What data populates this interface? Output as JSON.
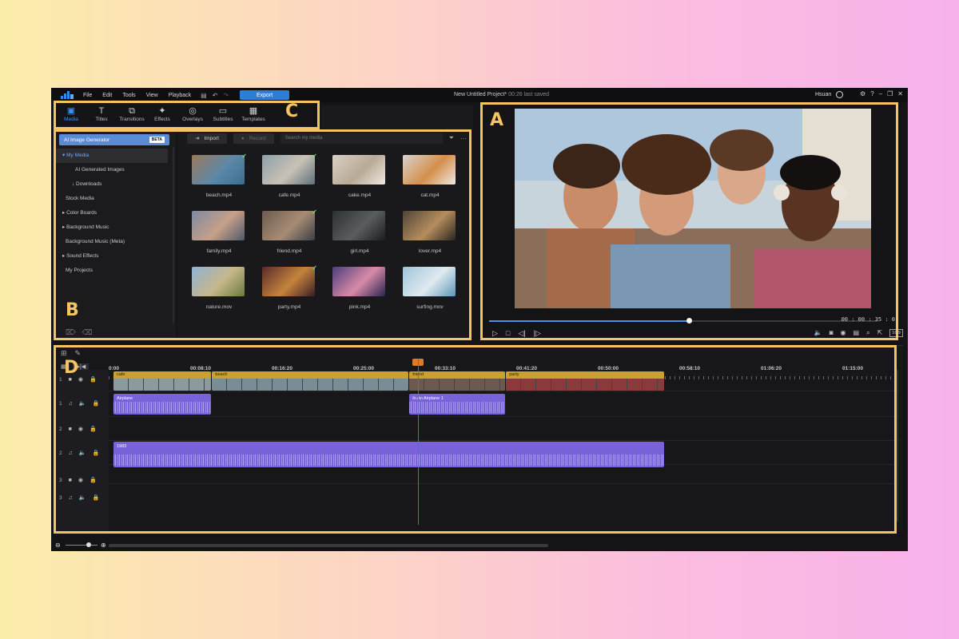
{
  "window": {
    "menu": [
      "File",
      "Edit",
      "Tools",
      "View",
      "Playback"
    ],
    "export_label": "Export",
    "project_title": "New Untitled Project*",
    "last_saved": "00:26 last saved",
    "user_name": "Hsuan"
  },
  "tabs": [
    {
      "label": "Media",
      "icon": "media-icon",
      "glyph": "▣",
      "active": true
    },
    {
      "label": "Titles",
      "icon": "titles-icon",
      "glyph": "T",
      "active": false
    },
    {
      "label": "Transitions",
      "icon": "transitions-icon",
      "glyph": "⧉",
      "active": false
    },
    {
      "label": "Effects",
      "icon": "effects-icon",
      "glyph": "✦",
      "active": false
    },
    {
      "label": "Overlays",
      "icon": "overlays-icon",
      "glyph": "◎",
      "active": false
    },
    {
      "label": "Subtitles",
      "icon": "subtitles-icon",
      "glyph": "▭",
      "active": false
    },
    {
      "label": "Templates",
      "icon": "templates-icon",
      "glyph": "▦",
      "active": false
    }
  ],
  "sidebar": {
    "ai_generator": "AI Image Generator",
    "beta": "BETA",
    "items": [
      {
        "label": "▾ My Media",
        "indent": 8,
        "selected": true
      },
      {
        "label": "AI Generated Images",
        "indent": 24,
        "selected": false
      },
      {
        "label": "↓ Downloads",
        "indent": 20,
        "selected": false
      },
      {
        "label": "Stock Media",
        "indent": 12,
        "selected": false
      },
      {
        "label": "▸ Color Boards",
        "indent": 8,
        "selected": false
      },
      {
        "label": "▸ Background Music",
        "indent": 8,
        "selected": false
      },
      {
        "label": "Background Music (Meta)",
        "indent": 12,
        "selected": false
      },
      {
        "label": "▸ Sound Effects",
        "indent": 8,
        "selected": false
      },
      {
        "label": "My Projects",
        "indent": 12,
        "selected": false
      }
    ]
  },
  "media": {
    "import_label": "Import",
    "record_label": "Record",
    "search_placeholder": "Search my media",
    "files": [
      {
        "name": "beach.mp4",
        "checked": true,
        "colors": [
          "#9c7a5a",
          "#5c88a8",
          "#3b6d8f"
        ]
      },
      {
        "name": "cafe.mp4",
        "checked": true,
        "colors": [
          "#8ea0a8",
          "#c9c2b6",
          "#5d6f78"
        ]
      },
      {
        "name": "cake.mp4",
        "checked": false,
        "colors": [
          "#d8d0c6",
          "#b9aa96",
          "#efe9e1"
        ]
      },
      {
        "name": "cat.mp4",
        "checked": false,
        "colors": [
          "#d8d3cd",
          "#d48f4c",
          "#efeae4"
        ]
      },
      {
        "name": "family.mp4",
        "checked": false,
        "colors": [
          "#7e8aa0",
          "#c7a08a",
          "#4d5a6a"
        ]
      },
      {
        "name": "friend.mp4",
        "checked": true,
        "colors": [
          "#6b5a50",
          "#a88c74",
          "#3a3e48"
        ]
      },
      {
        "name": "girl.mp4",
        "checked": false,
        "colors": [
          "#2e3134",
          "#5a5d60",
          "#1b1c1e"
        ]
      },
      {
        "name": "lover.mp4",
        "checked": false,
        "colors": [
          "#4f4438",
          "#b58d5e",
          "#2a2620"
        ]
      },
      {
        "name": "nature.mov",
        "checked": false,
        "colors": [
          "#8fb3d6",
          "#c7b68a",
          "#6a7a3c"
        ]
      },
      {
        "name": "party.mp4",
        "checked": true,
        "colors": [
          "#5a2a2a",
          "#c5843c",
          "#3a1c26"
        ]
      },
      {
        "name": "pink.mp4",
        "checked": false,
        "colors": [
          "#4b3f7c",
          "#d88aa8",
          "#2a2450"
        ]
      },
      {
        "name": "surfing.mov",
        "checked": false,
        "colors": [
          "#9fc4da",
          "#dfeaf0",
          "#5c96b8"
        ]
      }
    ]
  },
  "preview": {
    "timecode": "00 : 00 : 35 : 0",
    "progress": 0.51,
    "ratio": "16:9"
  },
  "timeline": {
    "ruler_labels": [
      "0:00",
      "00:08:10",
      "00:16:20",
      "00:25:00",
      "00:33:10",
      "00:41:20",
      "00:50:00",
      "00:58:10",
      "01:06:20",
      "01:15:00"
    ],
    "tracks": [
      {
        "number": "1",
        "type": "video"
      },
      {
        "number": "1",
        "type": "audio"
      },
      {
        "number": "2",
        "type": "video"
      },
      {
        "number": "2",
        "type": "audio"
      },
      {
        "number": "3",
        "type": "video"
      },
      {
        "number": "3",
        "type": "audio"
      }
    ],
    "video_clips": [
      {
        "label": "cafe",
        "start_s": 0,
        "end_s": 10.2,
        "color": "#8c9aa0"
      },
      {
        "label": "beach",
        "start_s": 10.2,
        "end_s": 30.6,
        "color": "#7a8c96"
      },
      {
        "label": "friend",
        "start_s": 30.6,
        "end_s": 40.6,
        "color": "#6b5a50"
      },
      {
        "label": "party",
        "start_s": 40.6,
        "end_s": 57.0,
        "color": "#8a3a3a"
      }
    ],
    "audio_clips": [
      {
        "label": "Airplane",
        "track": 1,
        "start_s": 0,
        "end_s": 10.2
      },
      {
        "label": "In An Airplane 1",
        "track": 1,
        "start_s": 30.6,
        "end_s": 40.6
      },
      {
        "label": "1983",
        "track": 2,
        "start_s": 0,
        "end_s": 57.0
      }
    ],
    "playhead_s": 31.5
  },
  "annotations": {
    "a": "A",
    "b": "B",
    "c": "C",
    "d": "D",
    "color": "#f5c460"
  }
}
